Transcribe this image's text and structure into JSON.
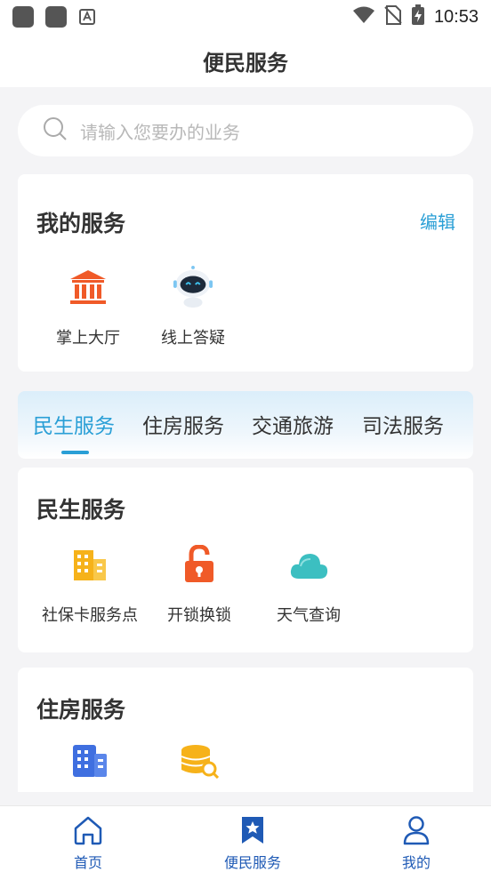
{
  "status_bar": {
    "time": "10:53",
    "icons": [
      "notification-square-icon",
      "notification-square-icon",
      "a-app-icon",
      "wifi-icon",
      "no-sim-icon",
      "battery-charging-icon"
    ]
  },
  "header": {
    "title": "便民服务"
  },
  "search": {
    "placeholder": "请输入您要办的业务"
  },
  "my_services": {
    "title": "我的服务",
    "edit_label": "编辑",
    "items": [
      {
        "label": "掌上大厅",
        "icon": "government-hall-icon"
      },
      {
        "label": "线上答疑",
        "icon": "robot-assistant-icon"
      }
    ]
  },
  "tabs": {
    "items": [
      {
        "label": "民生服务"
      },
      {
        "label": "住房服务"
      },
      {
        "label": "交通旅游"
      },
      {
        "label": "司法服务"
      }
    ],
    "active": "民生服务"
  },
  "section_livelihood": {
    "title": "民生服务",
    "items": [
      {
        "label": "社保卡服务点",
        "icon": "building-icon"
      },
      {
        "label": "开锁换锁",
        "icon": "unlock-icon"
      },
      {
        "label": "天气查询",
        "icon": "cloud-icon"
      }
    ]
  },
  "section_housing": {
    "title": "住房服务",
    "items": [
      {
        "icon": "office-building-icon"
      },
      {
        "icon": "coin-search-icon"
      }
    ]
  },
  "bottom_nav": {
    "items": [
      {
        "label": "首页",
        "icon": "home-icon"
      },
      {
        "label": "便民服务",
        "icon": "bookmark-star-icon"
      },
      {
        "label": "我的",
        "icon": "user-icon"
      }
    ]
  },
  "colors": {
    "accent": "#2a9fd6",
    "nav_blue": "#1f5ab5",
    "orange": "#f05a28",
    "background": "#f4f4f6"
  }
}
